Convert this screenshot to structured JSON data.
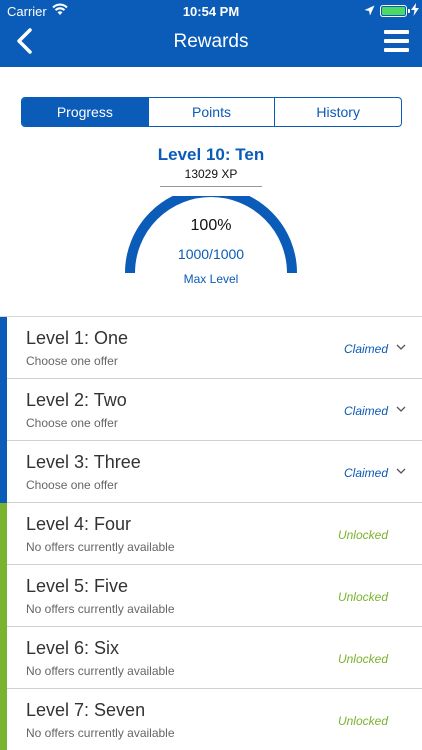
{
  "status_bar": {
    "carrier": "Carrier",
    "time": "10:54 PM",
    "battery_color": "#4cd964"
  },
  "nav": {
    "title": "Rewards",
    "back_icon": "chevron-left-icon",
    "menu_icon": "hamburger-menu-icon"
  },
  "tabs": [
    {
      "label": "Progress",
      "active": true
    },
    {
      "label": "Points",
      "active": false
    },
    {
      "label": "History",
      "active": false
    }
  ],
  "progress": {
    "level_title": "Level 10: Ten",
    "xp": "13029 XP",
    "percent_label": "100%",
    "value_label": "1000/1000",
    "caption": "Max Level",
    "fill_fraction": 1.0
  },
  "levels": [
    {
      "title": "Level 1: One",
      "subtitle": "Choose one offer",
      "status": "Claimed",
      "state": "claimed"
    },
    {
      "title": "Level 2: Two",
      "subtitle": "Choose one offer",
      "status": "Claimed",
      "state": "claimed"
    },
    {
      "title": "Level 3: Three",
      "subtitle": "Choose one offer",
      "status": "Claimed",
      "state": "claimed"
    },
    {
      "title": "Level 4: Four",
      "subtitle": "No offers currently available",
      "status": "Unlocked",
      "state": "unlocked"
    },
    {
      "title": "Level 5: Five",
      "subtitle": "No offers currently available",
      "status": "Unlocked",
      "state": "unlocked"
    },
    {
      "title": "Level 6: Six",
      "subtitle": "No offers currently available",
      "status": "Unlocked",
      "state": "unlocked"
    },
    {
      "title": "Level 7: Seven",
      "subtitle": "No offers currently available",
      "status": "Unlocked",
      "state": "unlocked"
    }
  ],
  "colors": {
    "brand": "#0b5bb8",
    "claimed": "#0b5bb8",
    "unlocked": "#7ab32e"
  }
}
